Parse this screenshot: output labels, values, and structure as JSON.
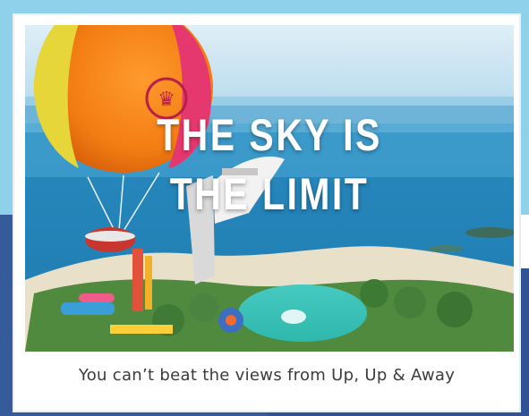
{
  "promo": {
    "headline_line1": "THE SKY IS",
    "headline_line2": "THE LIMIT",
    "caption": "You can’t beat the views from Up, Up & Away"
  },
  "colors": {
    "frame_light_blue": "#8fd1ea",
    "frame_dark_blue": "#2f5395",
    "caption_text": "#3b3b3b"
  }
}
